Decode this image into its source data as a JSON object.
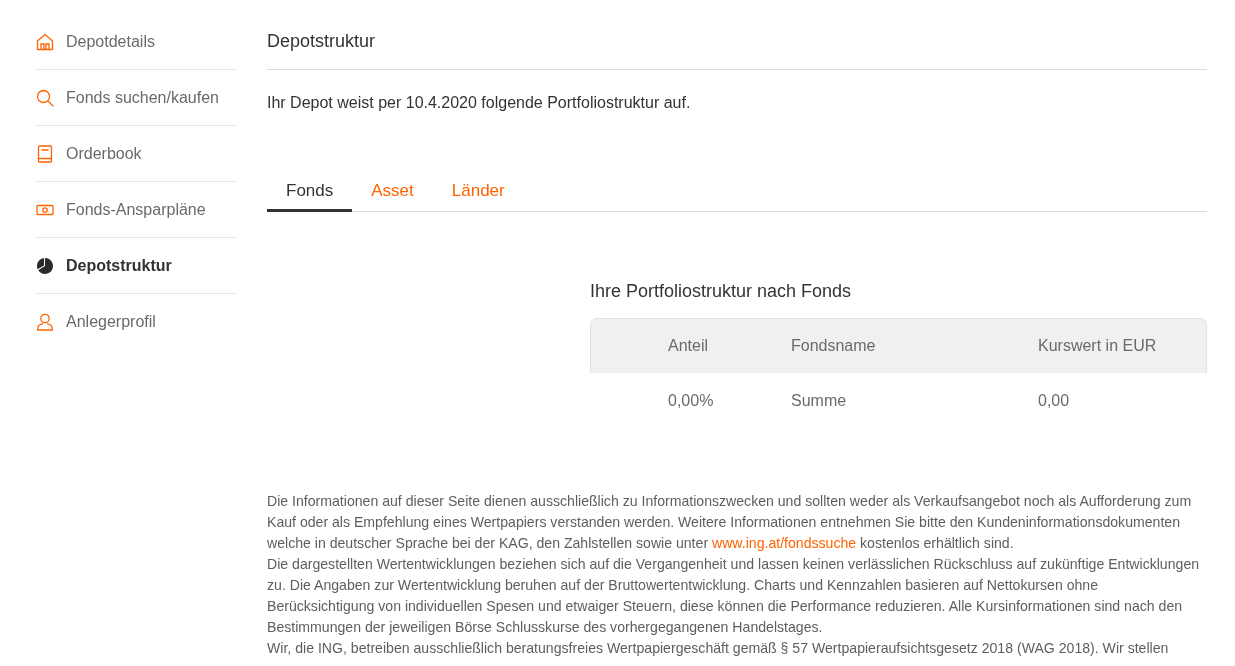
{
  "sidebar": {
    "items": [
      {
        "label": "Depotdetails",
        "selected": false
      },
      {
        "label": "Fonds suchen/kaufen",
        "selected": false
      },
      {
        "label": "Orderbook",
        "selected": false
      },
      {
        "label": "Fonds-Ansparpläne",
        "selected": false
      },
      {
        "label": "Depotstruktur",
        "selected": true
      },
      {
        "label": "Anlegerprofil",
        "selected": false
      }
    ]
  },
  "page": {
    "title": "Depotstruktur",
    "intro": "Ihr Depot weist per 10.4.2020 folgende Portfoliostruktur auf."
  },
  "tabs": [
    {
      "label": "Fonds",
      "selected": true
    },
    {
      "label": "Asset",
      "selected": false
    },
    {
      "label": "Länder",
      "selected": false
    }
  ],
  "table": {
    "title": "Ihre Portfoliostruktur nach Fonds",
    "columns": [
      "Anteil",
      "Fondsname",
      "Kurswert in EUR"
    ],
    "rows": [
      [
        "0,00%",
        "Summe",
        "0,00"
      ]
    ]
  },
  "disclaimer": [
    {
      "parts": [
        {
          "kind": "text",
          "text": "Die Informationen auf dieser Seite dienen ausschließlich zu Informationszwecken und sollten weder als Verkaufsangebot noch als Aufforderung zum Kauf oder als Empfehlung eines Wertpapiers verstanden werden. Weitere Informationen entnehmen Sie bitte den Kundeninformationsdokumenten welche in deutscher Sprache bei der KAG, den Zahlstellen sowie unter "
        },
        {
          "kind": "link",
          "text": "www.ing.at/fondssuche"
        },
        {
          "kind": "text",
          "text": " kostenlos erhältlich sind."
        }
      ]
    },
    {
      "parts": [
        {
          "kind": "text",
          "text": "Die dargestellten Wertentwicklungen beziehen sich auf die Vergangenheit und lassen keinen verlässlichen Rückschluss auf zukünftige Entwicklungen zu. Die Angaben zur Wertentwicklung beruhen auf der Bruttowertentwicklung. Charts und Kennzahlen basieren auf Nettokursen ohne Berücksichtigung von individuellen Spesen und etwaiger Steuern, diese können die Performance reduzieren. Alle Kursinformationen sind nach den Bestimmungen der jeweiligen Börse Schlusskurse des vorhergegangenen Handelstages."
        }
      ]
    },
    {
      "parts": [
        {
          "kind": "text",
          "text": "Wir, die ING, betreiben ausschließlich beratungsfreies Wertpapiergeschäft gemäß § 57 Wertpapieraufsichtsgesetz 2018 (WAG 2018). Wir stellen"
        }
      ]
    }
  ]
}
